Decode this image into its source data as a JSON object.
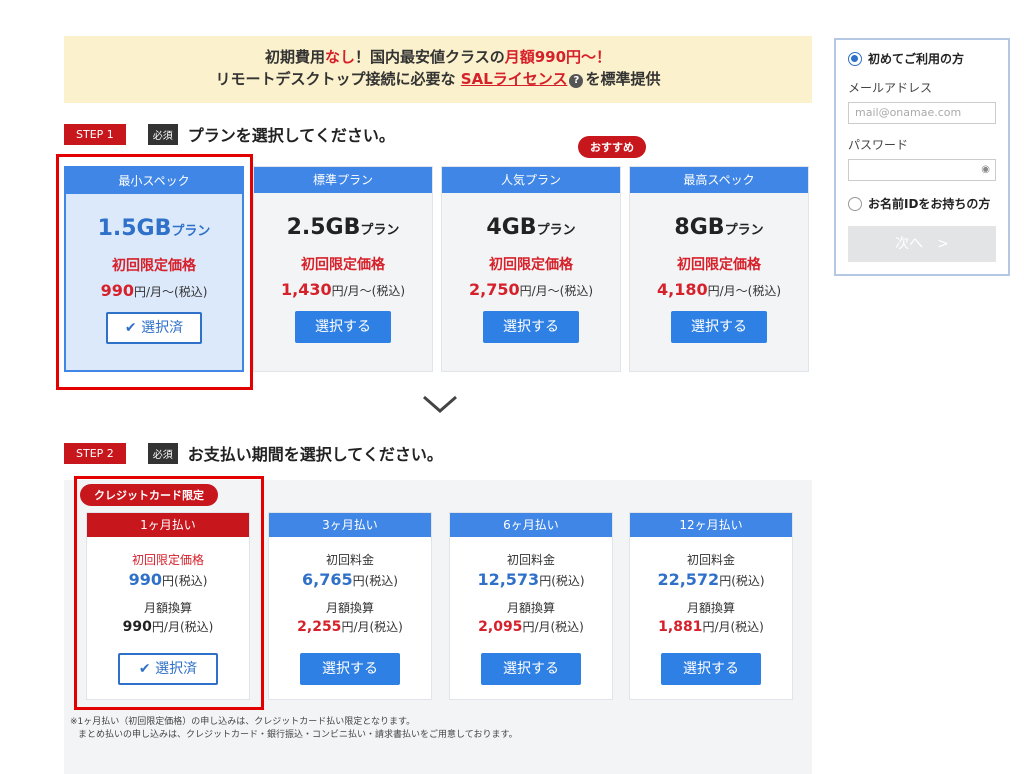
{
  "banner": {
    "line1_a": "初期費用",
    "line1_b": "なし",
    "line1_c": "！国内最安値クラスの",
    "line1_d": "月額990円",
    "line1_e": "〜！",
    "line2_a": "リモートデスクトップ接続に必要な",
    "line2_link": "SALライセンス",
    "line2_b": "を標準提供",
    "help_icon": "question-circle-icon"
  },
  "step1": {
    "badge": "STEP 1",
    "required": "必須",
    "title": "プランを選択してください。"
  },
  "recommend_badge": "おすすめ",
  "plans": [
    {
      "head": "最小スペック",
      "size": "1.5GB",
      "unit": "プラン",
      "label": "初回限定価格",
      "price": "990",
      "price_suffix": "円/月〜(税込)",
      "button": "選択済"
    },
    {
      "head": "標準プラン",
      "size": "2.5GB",
      "unit": "プラン",
      "label": "初回限定価格",
      "price": "1,430",
      "price_suffix": "円/月〜(税込)",
      "button": "選択する"
    },
    {
      "head": "人気プラン",
      "size": "4GB",
      "unit": "プラン",
      "label": "初回限定価格",
      "price": "2,750",
      "price_suffix": "円/月〜(税込)",
      "button": "選択する"
    },
    {
      "head": "最高スペック",
      "size": "8GB",
      "unit": "プラン",
      "label": "初回限定価格",
      "price": "4,180",
      "price_suffix": "円/月〜(税込)",
      "button": "選択する"
    }
  ],
  "step2": {
    "badge": "STEP 2",
    "required": "必須",
    "title": "お支払い期間を選択してください。"
  },
  "credit_badge": "クレジットカード限定",
  "payments": [
    {
      "head": "1ヶ月払い",
      "t1": "初回限定価格",
      "p1": "990",
      "p1_suffix": "円(税込)",
      "t3": "月額換算",
      "p2": "990",
      "p2_suffix": "円/月(税込)",
      "button": "選択済"
    },
    {
      "head": "3ヶ月払い",
      "t1": "初回料金",
      "p1": "6,765",
      "p1_suffix": "円(税込)",
      "t3": "月額換算",
      "p2": "2,255",
      "p2_suffix": "円/月(税込)",
      "button": "選択する"
    },
    {
      "head": "6ヶ月払い",
      "t1": "初回料金",
      "p1": "12,573",
      "p1_suffix": "円(税込)",
      "t3": "月額換算",
      "p2": "2,095",
      "p2_suffix": "円/月(税込)",
      "button": "選択する"
    },
    {
      "head": "12ヶ月払い",
      "t1": "初回料金",
      "p1": "22,572",
      "p1_suffix": "円(税込)",
      "t3": "月額換算",
      "p2": "1,881",
      "p2_suffix": "円/月(税込)",
      "button": "選択する"
    }
  ],
  "notes": {
    "line1": "※1ヶ月払い（初回限定価格）の申し込みは、クレジットカード払い限定となります。",
    "line2": "まとめ払いの申し込みは、クレジットカード・銀行振込・コンビニ払い・請求書払いをご用意しております。"
  },
  "login": {
    "option_new": "初めてご利用の方",
    "email_label": "メールアドレス",
    "email_placeholder": "mail@onamae.com",
    "password_label": "パスワード",
    "option_existing": "お名前IDをお持ちの方",
    "next_button": "次へ　>"
  },
  "colors": {
    "accent_blue": "#3f86e6",
    "brand_red": "#c8161d",
    "banner_bg": "#fbf1cc"
  }
}
